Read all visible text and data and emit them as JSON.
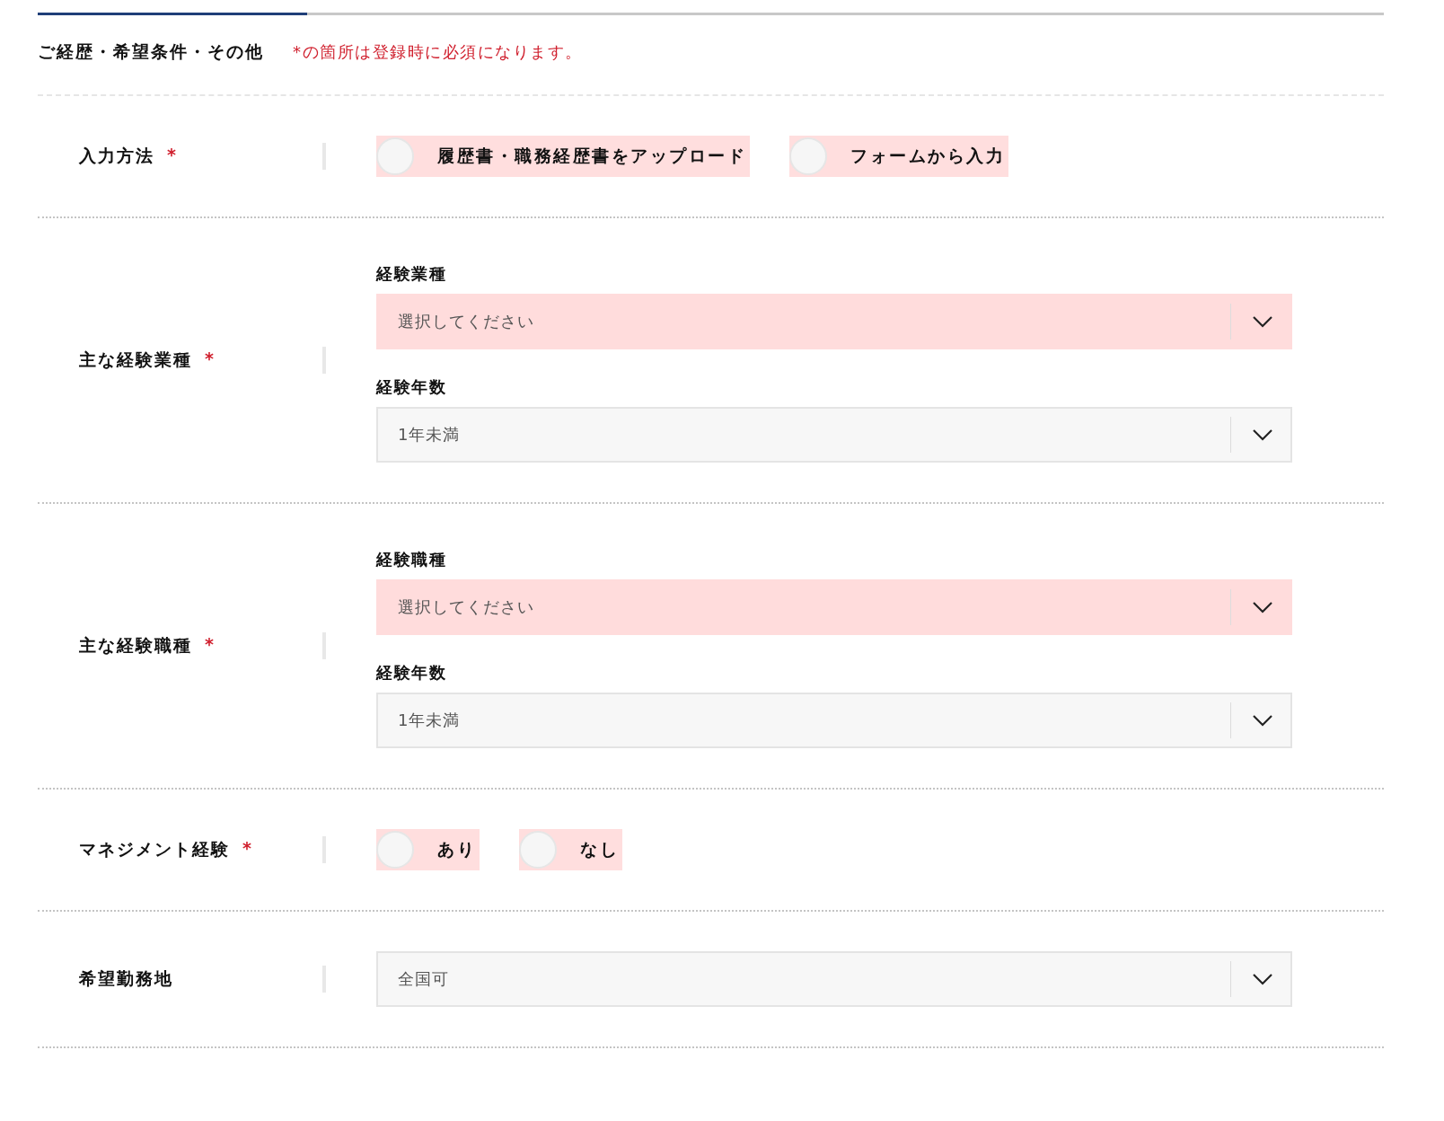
{
  "progress": {
    "level": 0.2
  },
  "section": {
    "title": "ご経歴・希望条件・その他",
    "note": "*の箇所は登録時に必須になります。"
  },
  "rows": [
    {
      "kind": "radio",
      "label": "入力方法",
      "required_mark": "*",
      "invalid": true,
      "options": [
        {
          "label": "履歴書・職務経歴書をアップロード",
          "selected": false
        },
        {
          "label": "フォームから入力",
          "selected": false
        }
      ]
    },
    {
      "kind": "selects",
      "label": "主な経験業種",
      "required_mark": "*",
      "fields": [
        {
          "label": "経験業種",
          "value": "選択してください",
          "invalid": true
        },
        {
          "label": "経験年数",
          "value": "1年未満",
          "invalid": false
        }
      ]
    },
    {
      "kind": "selects",
      "label": "主な経験職種",
      "required_mark": "*",
      "fields": [
        {
          "label": "経験職種",
          "value": "選択してください",
          "invalid": true
        },
        {
          "label": "経験年数",
          "value": "1年未満",
          "invalid": false
        }
      ]
    },
    {
      "kind": "radio",
      "label": "マネジメント経験",
      "required_mark": "*",
      "invalid": true,
      "options": [
        {
          "label": "あり",
          "selected": false
        },
        {
          "label": "なし",
          "selected": false
        }
      ]
    },
    {
      "kind": "select",
      "label": "希望勤務地",
      "value": "全国可",
      "invalid": false
    }
  ]
}
